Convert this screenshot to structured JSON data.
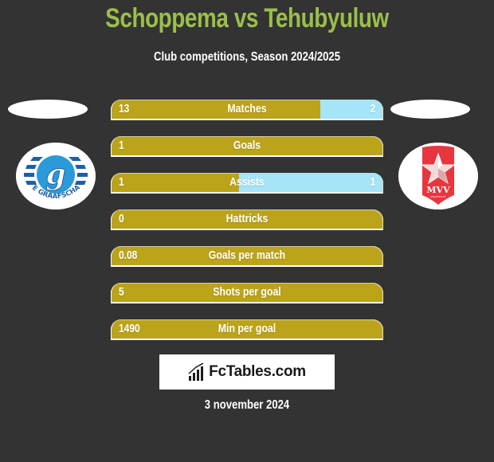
{
  "header": {
    "title": "Schoppema vs Tehubyuluw",
    "subtitle": "Club competitions, Season 2024/2025"
  },
  "teams": {
    "left": {
      "badge_icon": "de-graafschap-crest-icon",
      "badge_text": "DE GRAAFSCHAP"
    },
    "right": {
      "badge_icon": "mvv-maastricht-crest-icon",
      "badge_text": "MVV",
      "badge_subtext": "MAASTRICHT"
    }
  },
  "colors": {
    "title": "#9bbf4a",
    "left_bar": "#bba31a",
    "right_bar": "#a6e4f7",
    "background": "#333333"
  },
  "stats": [
    {
      "label": "Matches",
      "left": "13",
      "right": "2",
      "left_share": 0.77
    },
    {
      "label": "Goals",
      "left": "1",
      "right": "",
      "left_share": 1.0
    },
    {
      "label": "Assists",
      "left": "1",
      "right": "1",
      "left_share": 0.47
    },
    {
      "label": "Hattricks",
      "left": "0",
      "right": "",
      "left_share": 1.0
    },
    {
      "label": "Goals per match",
      "left": "0.08",
      "right": "",
      "left_share": 1.0
    },
    {
      "label": "Shots per goal",
      "left": "5",
      "right": "",
      "left_share": 1.0
    },
    {
      "label": "Min per goal",
      "left": "1490",
      "right": "",
      "left_share": 1.0
    }
  ],
  "footer": {
    "brand": "FcTables.com",
    "brand_icon": "bar-chart-icon",
    "date": "3 november 2024"
  }
}
